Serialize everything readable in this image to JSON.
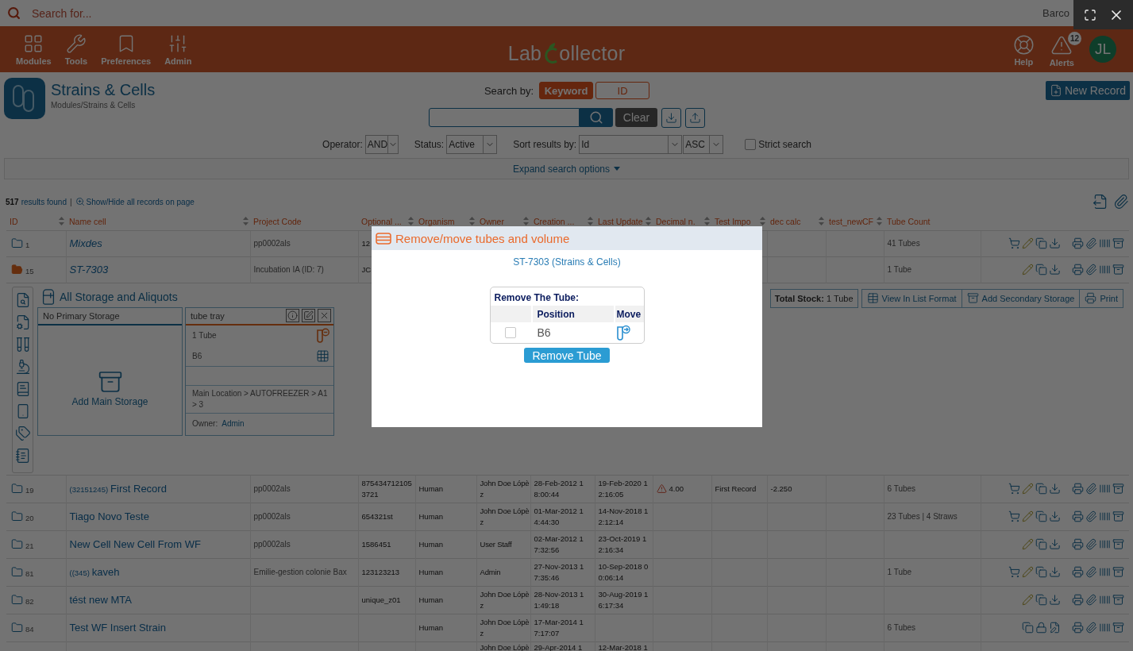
{
  "search": {
    "placeholder": "Search for..."
  },
  "barcode_label": "Barco",
  "header": {
    "nav": [
      {
        "label": "Modules"
      },
      {
        "label": "Tools"
      },
      {
        "label": "Preferences"
      },
      {
        "label": "Admin"
      }
    ],
    "logo": {
      "start": "Lab",
      "end": "ollector"
    },
    "help": {
      "label": "Help"
    },
    "alerts": {
      "label": "Alerts",
      "badge": "12"
    },
    "avatar": {
      "initials": "JL"
    }
  },
  "module": {
    "title": "Strains & Cells",
    "breadcrumb": "Modules/Strains & Cells"
  },
  "search_by": {
    "label": "Search by:",
    "options": [
      {
        "label": "Keyword",
        "selected": true
      },
      {
        "label": "ID",
        "selected": false
      }
    ]
  },
  "record_search": {
    "clear_button": "Clear"
  },
  "new_record_button": "New Record",
  "options": {
    "operator": {
      "label": "Operator:",
      "value": "AND"
    },
    "status": {
      "label": "Status:",
      "value": "Active"
    },
    "sort": {
      "label": "Sort results by:",
      "field": "Id",
      "order": "ASC"
    },
    "strict_search": {
      "label": "Strict search",
      "checked": false
    }
  },
  "expand_search": "Expand search options",
  "results": {
    "count": "517",
    "text": "results found",
    "separator": "|",
    "toggle": "Show/Hide all records on page"
  },
  "table": {
    "columns": [
      {
        "label": "ID",
        "sortable": true
      },
      {
        "label": "Name cell",
        "sortable": true
      },
      {
        "label": "Project Code",
        "sortable": false
      },
      {
        "label": "Optional ...",
        "sortable": true
      },
      {
        "label": "Organism",
        "sortable": true
      },
      {
        "label": "Owner",
        "sortable": true
      },
      {
        "label": "Creation ...",
        "sortable": true
      },
      {
        "label": "Last Update",
        "sortable": true
      },
      {
        "label": "Decimal n.",
        "sortable": true
      },
      {
        "label": "Test Impo",
        "sortable": true
      },
      {
        "label": "dec calc",
        "sortable": true
      },
      {
        "label": "test_newCF",
        "sortable": true
      },
      {
        "label": "Tube Count",
        "sortable": false
      }
    ],
    "rows": [
      {
        "id": "1",
        "expanded": false,
        "italic": true,
        "warning": false,
        "name": "Mixdes",
        "project_code": "pp0002als",
        "optional": "12",
        "tube_count": "41 Tubes",
        "actions": [
          {
            "kind": "order"
          },
          {
            "kind": "edit"
          },
          {
            "kind": "duplicate"
          },
          {
            "kind": "download"
          }
        ],
        "tools": [
          {
            "kind": "print"
          },
          {
            "kind": "attach"
          },
          {
            "kind": "barcode"
          },
          {
            "kind": "storage"
          }
        ]
      },
      {
        "id": "15",
        "expanded": true,
        "italic": true,
        "warning": false,
        "name": "ST-7303",
        "project_code": "Incubation IA (ID: 7)",
        "optional": "JC",
        "tube_count": "1 Tube",
        "actions": [
          {
            "kind": "edit"
          },
          {
            "kind": "duplicate"
          },
          {
            "kind": "download"
          }
        ],
        "tools": [
          {
            "kind": "print"
          },
          {
            "kind": "attach"
          },
          {
            "kind": "barcode"
          },
          {
            "kind": "storage"
          }
        ],
        "storage": {
          "title": "All Storage and Aliquots",
          "primary": {
            "title": "No Primary Storage",
            "action": "Add Main Storage"
          },
          "containers": [
            {
              "title": "tube tray",
              "count": "1 Tube",
              "position": "B6",
              "location": "Main Location > AUTOFREEZER > A1 > 3",
              "owner_label": "Owner:",
              "owner": "Admin"
            }
          ],
          "stock": {
            "label": "Total Stock:",
            "value": "1 Tube"
          },
          "buttons": [
            "View In List Format",
            "Add Secondary Storage",
            "Print"
          ]
        }
      },
      {
        "id": "19",
        "expanded": false,
        "italic": false,
        "warning": true,
        "prefix": "(32151245)",
        "name": "First Record",
        "project_code": "pp0002als",
        "optional": "8754347121053721",
        "organism": "Human",
        "owner": "John Doe Lópèz",
        "created": "28-Feb-2012 18:00:44",
        "updated": "19-Feb-2020 12:16:05",
        "decimal": "4.00",
        "test_impo": "First Record",
        "dec_calc": "-2.250",
        "tube_count": "6 Tubes",
        "actions": [
          {
            "kind": "order"
          },
          {
            "kind": "edit"
          },
          {
            "kind": "duplicate"
          },
          {
            "kind": "download"
          }
        ],
        "tools": [
          {
            "kind": "print"
          },
          {
            "kind": "attach"
          },
          {
            "kind": "barcode"
          },
          {
            "kind": "storage"
          }
        ]
      },
      {
        "id": "20",
        "expanded": false,
        "italic": false,
        "warning": false,
        "name": "Tiago Novo Teste",
        "project_code": "pp0002als",
        "optional": "654321st",
        "organism": "Human",
        "owner": "John Doe Lópèz",
        "created": "01-Mar-2012 14:44:30",
        "updated": "14-Nov-2018 12:12:14",
        "tube_count": "23 Tubes | 4 Straws",
        "actions": [
          {
            "kind": "order"
          },
          {
            "kind": "edit"
          },
          {
            "kind": "duplicate"
          },
          {
            "kind": "download"
          }
        ],
        "tools": [
          {
            "kind": "print"
          },
          {
            "kind": "attach"
          },
          {
            "kind": "barcode"
          },
          {
            "kind": "storage"
          }
        ]
      },
      {
        "id": "21",
        "expanded": false,
        "italic": false,
        "warning": false,
        "name": "New Cell New Cell From WF",
        "project_code": "pp0002als",
        "optional": "1586451",
        "organism": "Human",
        "owner": "User Staff",
        "created": "02-Mar-2012 17:32:56",
        "updated": "23-Oct-2019 12:16:34",
        "actions": [
          {
            "kind": "edit"
          },
          {
            "kind": "duplicate"
          },
          {
            "kind": "download"
          }
        ],
        "tools": [
          {
            "kind": "print"
          },
          {
            "kind": "attach"
          },
          {
            "kind": "barcode"
          },
          {
            "kind": "storage"
          }
        ]
      },
      {
        "id": "81",
        "expanded": false,
        "italic": false,
        "warning": false,
        "prefix": "((345)",
        "name": "kaveh",
        "project_code": "Emilie-gestion colonie Bax",
        "optional": "123123213",
        "organism": "Human",
        "owner": "Admin",
        "created": "27-Nov-2013 17:35:46",
        "updated": "10-Sep-2018 00:06:14",
        "tube_count": "1 Tube",
        "actions": [
          {
            "kind": "order"
          },
          {
            "kind": "edit"
          },
          {
            "kind": "duplicate"
          },
          {
            "kind": "download"
          }
        ],
        "tools": [
          {
            "kind": "print"
          },
          {
            "kind": "attach"
          },
          {
            "kind": "barcode"
          },
          {
            "kind": "storage"
          }
        ]
      },
      {
        "id": "82",
        "expanded": false,
        "italic": false,
        "warning": false,
        "name": "tést new MTA",
        "optional": "unique_z01",
        "organism": "Human",
        "owner": "John Doe Lópèz",
        "created": "28-Nov-2013 11:49:18",
        "updated": "30-Aug-2019 16:17:34",
        "actions": [
          {
            "kind": "edit"
          },
          {
            "kind": "duplicate"
          },
          {
            "kind": "download"
          }
        ],
        "tools": [
          {
            "kind": "print"
          },
          {
            "kind": "attach"
          },
          {
            "kind": "barcode"
          },
          {
            "kind": "storage"
          }
        ]
      },
      {
        "id": "84",
        "expanded": false,
        "italic": false,
        "warning": false,
        "name": "Test WF Insert Strain",
        "organism": "Human",
        "owner": "John Doe Lópèz",
        "created": "17-Mar-2014 17:17:07",
        "tube_count": "6 Tubes",
        "actions": [
          {
            "kind": "duplicate"
          },
          {
            "kind": "lock"
          },
          {
            "kind": "edit_file"
          }
        ],
        "tools": [
          {
            "kind": "print"
          },
          {
            "kind": "attach"
          },
          {
            "kind": "barcode"
          },
          {
            "kind": "storage"
          }
        ]
      },
      {
        "owner": "John Doe Lópè",
        "created": "29-Apr-2014 1",
        "updated": "12-Mar-2018 1"
      }
    ]
  },
  "modal": {
    "title": "Remove/move tubes and volume",
    "record_link": "ST-7303 (Strains & Cells)",
    "section_title": "Remove The Tube:",
    "columns": [
      "Position",
      "Move"
    ],
    "tubes": [
      {
        "position": "B6",
        "checked": false
      }
    ],
    "button": "Remove Tube"
  }
}
